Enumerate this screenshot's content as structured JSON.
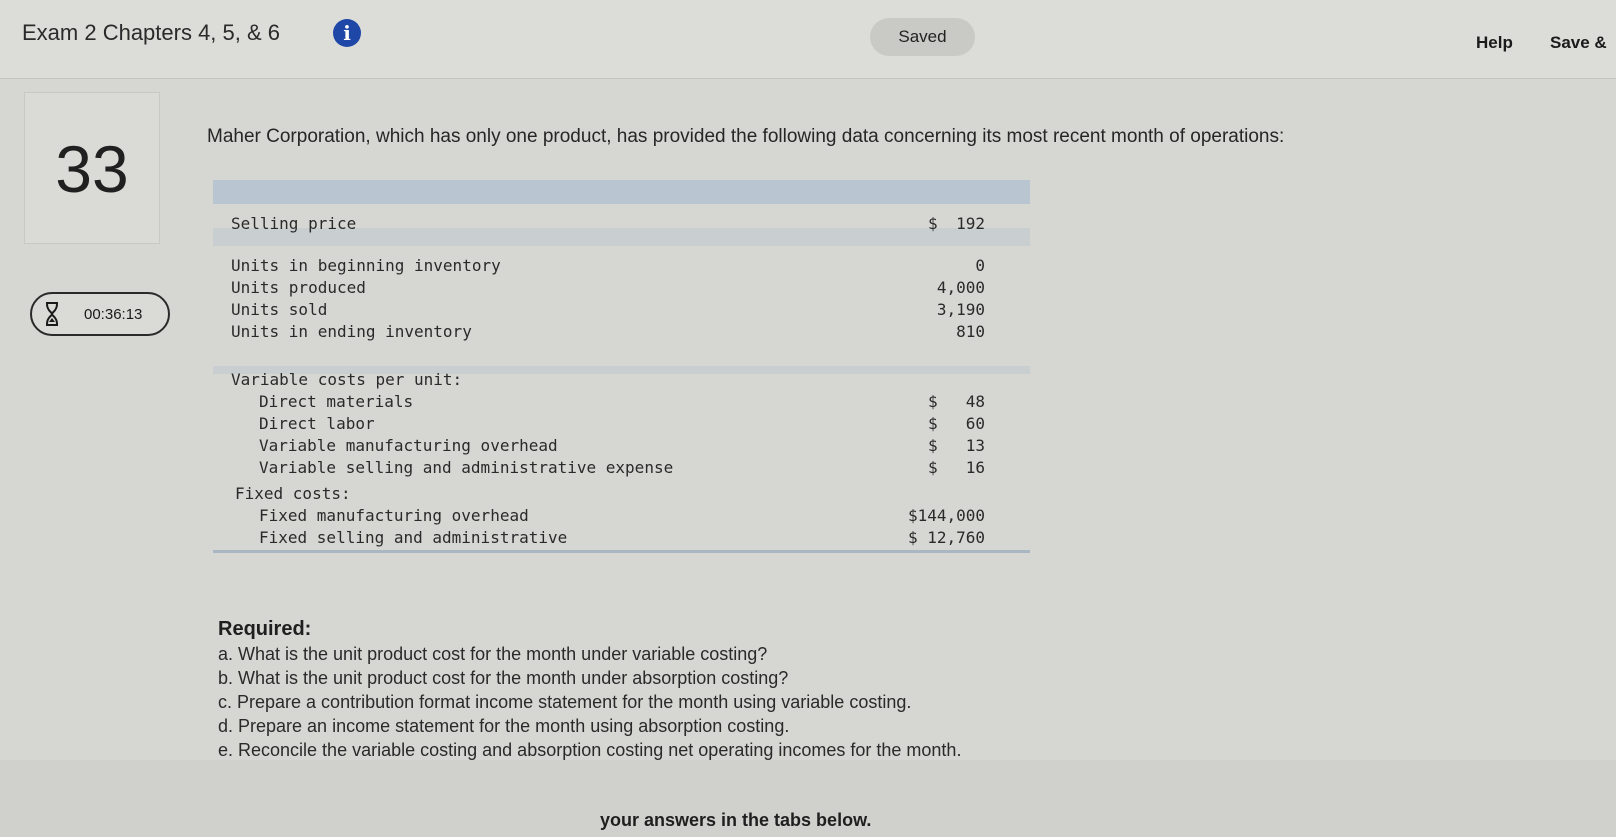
{
  "header": {
    "exam_title": "Exam 2 Chapters 4, 5, & 6",
    "info_icon": "info-icon",
    "saved_label": "Saved",
    "help_label": "Help",
    "save_exit_label": "Save &"
  },
  "question": {
    "number": "33",
    "timer": "00:36:13",
    "prompt": "Maher Corporation, which has only one product, has provided the following data concerning its most recent month of operations:"
  },
  "table": {
    "selling_price": {
      "label": "Selling price",
      "currency": "$",
      "value": "192"
    },
    "units": [
      {
        "label": "Units in beginning inventory",
        "value": "0"
      },
      {
        "label": "Units produced",
        "value": "4,000"
      },
      {
        "label": "Units sold",
        "value": "3,190"
      },
      {
        "label": "Units in ending inventory",
        "value": "810"
      }
    ],
    "variable_header": "Variable costs per unit:",
    "variable_costs": [
      {
        "label": "Direct materials",
        "currency": "$",
        "value": "48"
      },
      {
        "label": "Direct labor",
        "currency": "$",
        "value": "60"
      },
      {
        "label": "Variable manufacturing overhead",
        "currency": "$",
        "value": "13"
      },
      {
        "label": "Variable selling and administrative expense",
        "currency": "$",
        "value": "16"
      }
    ],
    "fixed_header": "Fixed costs:",
    "fixed_costs": [
      {
        "label": "Fixed manufacturing overhead",
        "value": "$144,000"
      },
      {
        "label": "Fixed selling and administrative",
        "value": "$ 12,760"
      }
    ]
  },
  "required": {
    "title": "Required:",
    "items": [
      "a. What is the unit product cost for the month under variable costing?",
      "b. What is the unit product cost for the month under absorption costing?",
      "c. Prepare a contribution format income statement for the month using variable costing.",
      "d. Prepare an income statement for the month using absorption costing.",
      "e. Reconcile the variable costing and absorption costing net operating incomes for the month."
    ]
  },
  "tabs_instruction": "your answers in the tabs below."
}
